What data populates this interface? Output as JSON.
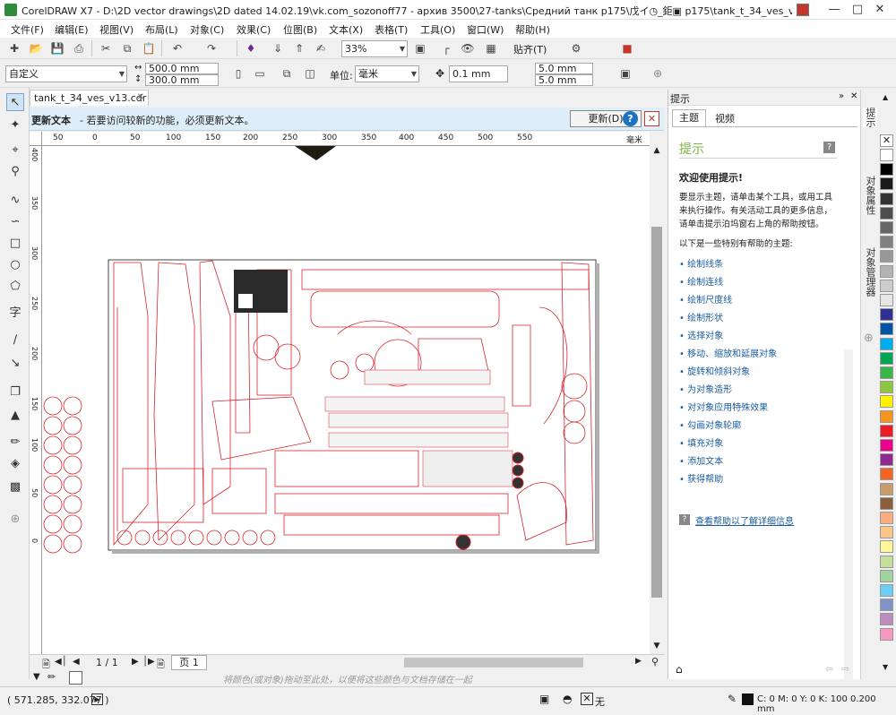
{
  "window": {
    "title": "CorelDRAW X7 - D:\\2D vector drawings\\2D dated 14.02.19\\vk.com_sozonoff77 - архив 3500\\27-tanks\\Средний танк р175\\戊イ◷_鉅▣ р175\\tank_t_34_ves_v13.cdr"
  },
  "menu": [
    "文件(F)",
    "编辑(E)",
    "视图(V)",
    "布局(L)",
    "对象(C)",
    "效果(C)",
    "位图(B)",
    "文本(X)",
    "表格(T)",
    "工具(O)",
    "窗口(W)",
    "帮助(H)"
  ],
  "standard_toolbar": {
    "zoom": "33%",
    "snap_label": "贴齐(T)"
  },
  "property_bar": {
    "preset": "自定义",
    "width": "500.0 mm",
    "height": "300.0 mm",
    "unit_label": "单位:",
    "unit_value": "毫米",
    "nudge": "0.1 mm",
    "dup_x": "5.0 mm",
    "dup_y": "5.0 mm"
  },
  "document_tab": "tank_t_34_ves_v13.cdr",
  "infobar": {
    "title": "更新文本",
    "message": "- 若要访问较新的功能，必须更新文本。",
    "button": "更新(D)"
  },
  "ruler_h": [
    "50",
    "0",
    "50",
    "100",
    "150",
    "200",
    "250",
    "300",
    "350",
    "400",
    "450",
    "500",
    "550",
    "毫米"
  ],
  "ruler_v": [
    "400",
    "350",
    "300",
    "250",
    "200",
    "150",
    "100",
    "50",
    "0"
  ],
  "page_nav": {
    "current": "1 / 1",
    "tab": "页 1"
  },
  "palette_hint": "将颜色(或对象)拖动至此处，以便将这些颜色与文档存储在一起",
  "docker": {
    "header": "提示",
    "tabs": [
      "主题",
      "视频"
    ],
    "panel_title": "提示",
    "welcome": "欢迎使用提示!",
    "intro": "要显示主题，请单击某个工具，或用工具来执行操作。有关活动工具的更多信息，请单击提示泊坞窗右上角的帮助按钮。",
    "list_heading": "以下是一些特别有帮助的主题:",
    "links": [
      "绘制线条",
      "绘制连线",
      "绘制尺度线",
      "绘制形状",
      "选择对象",
      "移动、缩放和延展对象",
      "旋转和倾斜对象",
      "为对象造形",
      "对对象应用特殊效果",
      "勾画对象轮廓",
      "填充对象",
      "添加文本",
      "获得帮助"
    ],
    "more_help": "查看帮助以了解详细信息"
  },
  "docker_side_tabs": [
    "提示",
    "对象属性",
    "对象管理器"
  ],
  "palette_colors": [
    "#ffffff",
    "#000000",
    "#1a1a1a",
    "#333333",
    "#4d4d4d",
    "#666666",
    "#808080",
    "#999999",
    "#b3b3b3",
    "#cccccc",
    "#e6e6e6",
    "#2e3192",
    "#0054a6",
    "#00aeef",
    "#00a651",
    "#39b54a",
    "#8dc63f",
    "#fff200",
    "#f7941d",
    "#ed1c24",
    "#ec008c",
    "#92278f",
    "#f26522",
    "#c69c6d",
    "#8b5e3c",
    "#f9ad81",
    "#fdc689",
    "#fff799",
    "#c4df9b",
    "#a2d39c",
    "#6dcff6",
    "#8393ca",
    "#bd8cbf",
    "#f49ac1"
  ],
  "status": {
    "coords": "( 571.285, 332.077 )",
    "fill_label": "无",
    "outline": "C: 0 M: 0 Y: 0 K: 100  0.200 mm"
  }
}
